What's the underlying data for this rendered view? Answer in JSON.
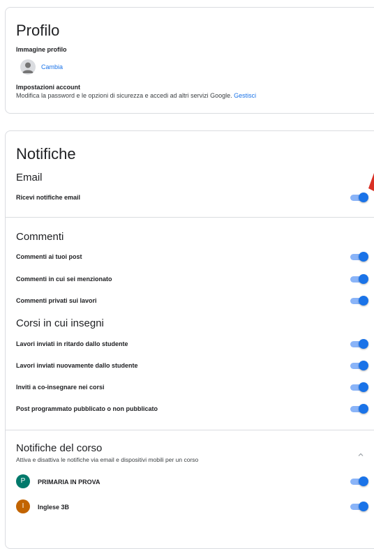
{
  "profile": {
    "title": "Profilo",
    "image_label": "Immagine profilo",
    "change_link": "Cambia",
    "account_label": "Impostazioni account",
    "account_desc": "Modifica la password e le opzioni di sicurezza e accedi ad altri servizi Google.",
    "manage_link": "Gestisci"
  },
  "notifications": {
    "title": "Notifiche",
    "email": {
      "heading": "Email",
      "toggles": [
        {
          "label": "Ricevi notifiche email",
          "on": true
        }
      ]
    },
    "comments": {
      "heading": "Commenti",
      "toggles": [
        {
          "label": "Commenti ai tuoi post",
          "on": true
        },
        {
          "label": "Commenti in cui sei menzionato",
          "on": true
        },
        {
          "label": "Commenti privati sui lavori",
          "on": true
        }
      ]
    },
    "teaching": {
      "heading": "Corsi in cui insegni",
      "toggles": [
        {
          "label": "Lavori inviati in ritardo dallo studente",
          "on": true
        },
        {
          "label": "Lavori inviati nuovamente dallo studente",
          "on": true
        },
        {
          "label": "Inviti a co-insegnare nei corsi",
          "on": true
        },
        {
          "label": "Post programmato pubblicato o non pubblicato",
          "on": true
        }
      ]
    },
    "course": {
      "heading": "Notifiche del corso",
      "subtitle": "Attiva e disattiva le notifiche via email e dispositivi mobili per un corso",
      "courses": [
        {
          "initial": "P",
          "name": "PRIMARIA IN PROVA",
          "color": "#00796b",
          "on": true
        },
        {
          "initial": "I",
          "name": "Inglese 3B",
          "color": "#c26401",
          "on": true
        }
      ]
    }
  },
  "colors": {
    "toggle_on": "#1a73e8",
    "toggle_track": "#8ab4f8",
    "link": "#1a73e8",
    "annotation_arrow": "#d93025"
  }
}
